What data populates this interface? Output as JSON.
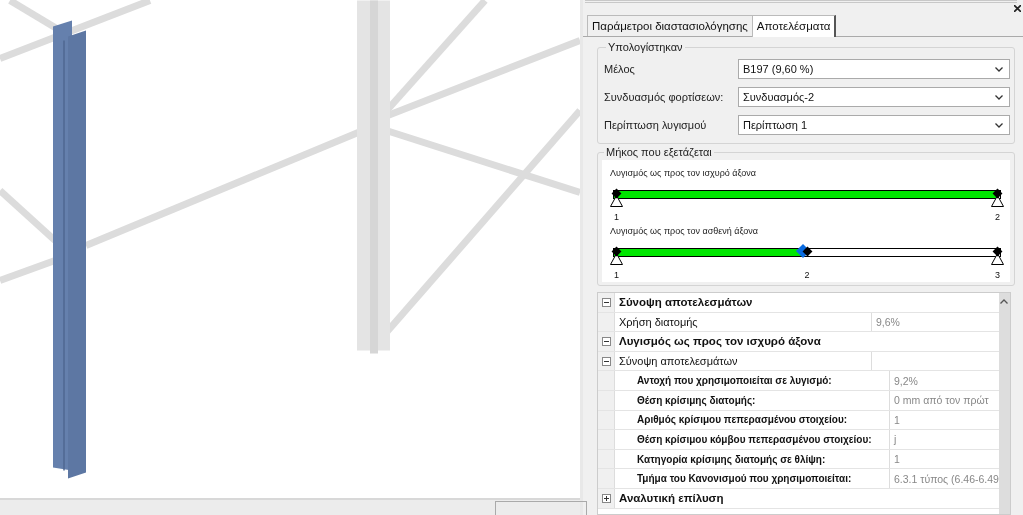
{
  "tabs": [
    {
      "label": "Παράμετροι διαστασιολόγησης",
      "selected": false
    },
    {
      "label": "Αποτελέσματα",
      "selected": true
    }
  ],
  "computed": {
    "title": "Υπολογίστηκαν",
    "fields": [
      {
        "label": "Μέλος",
        "value": "B197 (9,60 %)"
      },
      {
        "label": "Συνδυασμός φορτίσεων:",
        "value": "Συνδυασμός-2"
      },
      {
        "label": "Περίπτωση λυγισμού",
        "value": "Περίπτωση 1"
      }
    ]
  },
  "length": {
    "title": "Μήκος που εξετάζεται",
    "beams": [
      {
        "title": "Λυγισμός ως προς τον ισχυρό άξονα",
        "level": 1,
        "nodes": [
          {
            "label": "1",
            "support": true
          },
          {
            "label": "2",
            "support": true
          }
        ]
      },
      {
        "title": "Λυγισμός ως προς τον ασθενή άξονα",
        "level": 0.49,
        "nodes": [
          {
            "label": "1",
            "support": true
          },
          {
            "label": "2",
            "support": false
          },
          {
            "label": "3",
            "support": true
          }
        ]
      }
    ]
  },
  "results": {
    "rows": [
      {
        "label": "Σύνοψη αποτελεσμάτων",
        "expanded": true,
        "children": [
          {
            "label": "Χρήση διατομής",
            "value": "9,6%"
          }
        ]
      },
      {
        "label": "Λυγισμός ως προς τον ισχυρό άξονα",
        "expanded": true,
        "children": [
          {
            "label": "Σύνοψη αποτελεσμάτων",
            "expanded": true,
            "children": [
              {
                "label": "Αντοχή που χρησιμοποιείται σε λυγισμό:",
                "value": "9,2%"
              },
              {
                "label": "Θέση κρίσιμης διατομής:",
                "value": "0 mm από τον πρώτ"
              },
              {
                "label": "Αριθμός κρίσιμου πεπερασμένου στοιχείου:",
                "value": "1"
              },
              {
                "label": "Θέση κρίσιμου κόμβου πεπερασμένου στοιχείου:",
                "value": "j"
              },
              {
                "label": "Κατηγορία κρίσιμης διατομής σε θλίψη:",
                "value": "1"
              },
              {
                "label": "Τμήμα του Κανονισμού που χρησιμοποιείται:",
                "value": "6.3.1 τύπος (6.46-6.49"
              }
            ]
          }
        ]
      },
      {
        "label": "Αναλυτική επίλυση",
        "expanded": false
      }
    ]
  }
}
